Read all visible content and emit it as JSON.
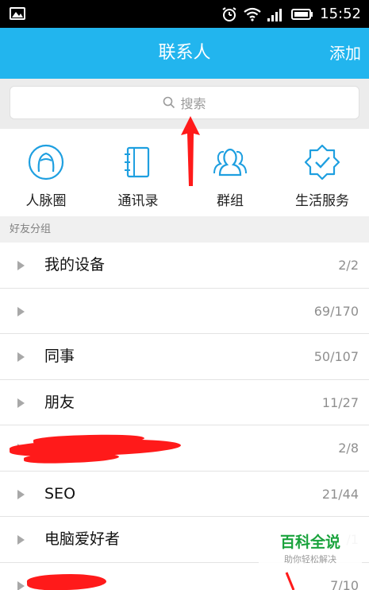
{
  "status_bar": {
    "time": "15:52",
    "icons": [
      "gallery-icon",
      "alarm-icon",
      "wifi-icon",
      "signal-icon",
      "battery-icon"
    ]
  },
  "header": {
    "title": "联系人",
    "add_label": "添加"
  },
  "search": {
    "placeholder": "搜索"
  },
  "quick_actions": [
    {
      "label": "人脉圈",
      "icon": "person-circle-icon"
    },
    {
      "label": "通讯录",
      "icon": "address-book-icon"
    },
    {
      "label": "群组",
      "icon": "group-icon"
    },
    {
      "label": "生活服务",
      "icon": "service-badge-icon"
    }
  ],
  "section": {
    "title": "好友分组"
  },
  "groups": [
    {
      "name": "我的设备",
      "count": "2/2"
    },
    {
      "name": "",
      "count": "69/170"
    },
    {
      "name": "同事",
      "count": "50/107"
    },
    {
      "name": "朋友",
      "count": "11/27"
    },
    {
      "name": "",
      "count": "2/8"
    },
    {
      "name": "SEO",
      "count": "21/44"
    },
    {
      "name": "电脑爱好者",
      "count": "/1"
    },
    {
      "name": "",
      "count": "7/10"
    }
  ],
  "watermark": {
    "main": "百科全说",
    "sub": "助你轻松解决"
  },
  "colors": {
    "title_bar": "#22b5ee",
    "icon_blue": "#1e9fe0",
    "annotation_red": "#ff1a1a",
    "watermark_green": "#1aa33d"
  }
}
